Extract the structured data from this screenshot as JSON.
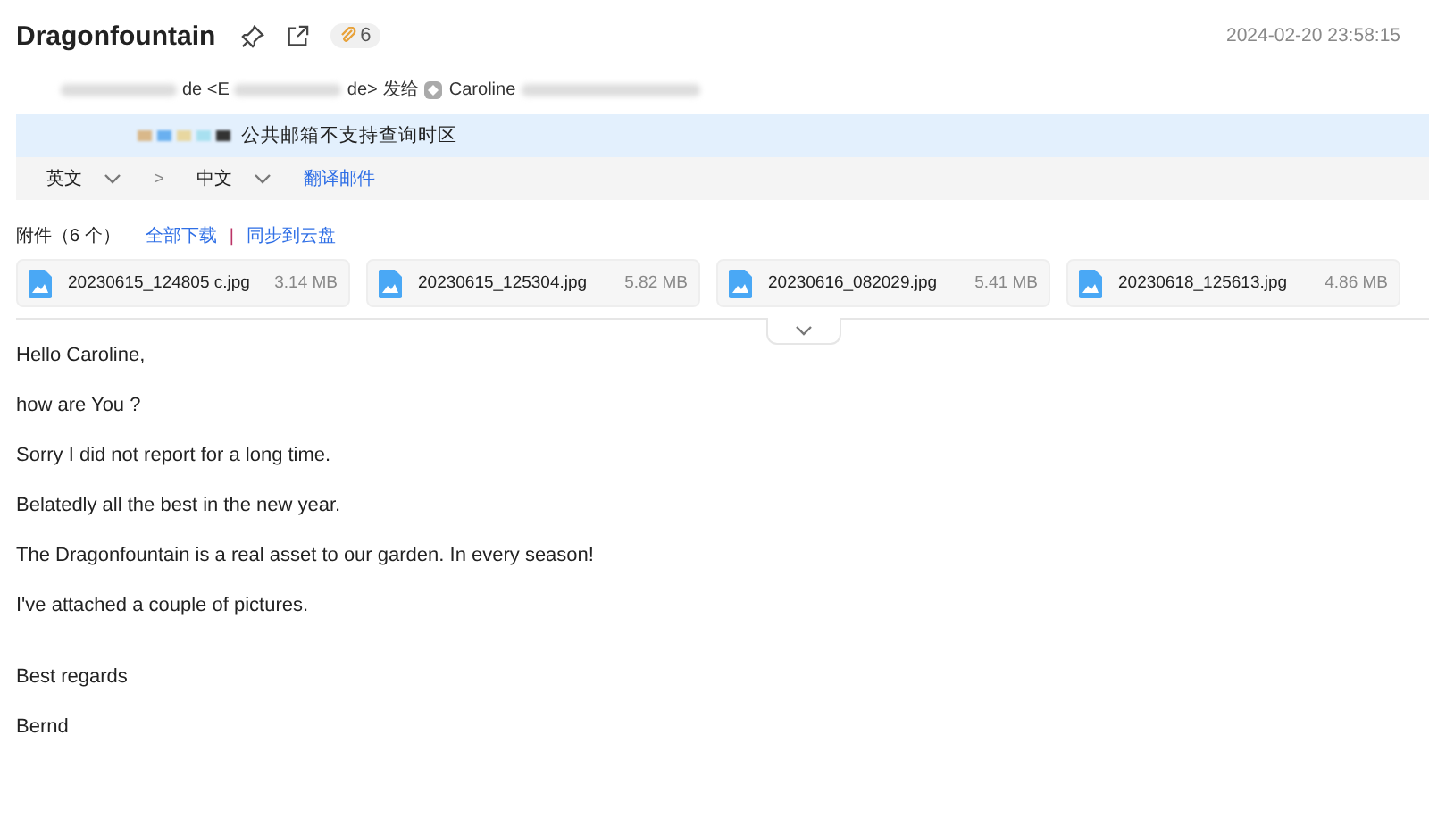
{
  "header": {
    "subject": "Dragonfountain",
    "attachment_count": "6",
    "date": "2024-02-20 23:58:15"
  },
  "sender_line": {
    "sender_start": "de <E",
    "sender_end": "de>",
    "sent_to": "发给",
    "recipient": "Caroline"
  },
  "timezone_notice": "公共邮箱不支持查询时区",
  "translate_bar": {
    "source_language": "英文",
    "separator": ">",
    "target_language": "中文",
    "action": "翻译邮件"
  },
  "attachments": {
    "title": "附件（6 个）",
    "download_all": "全部下载",
    "separator": "|",
    "save_to_cloud": "同步到云盘",
    "files": [
      {
        "name": "20230615_124805 c.jpg",
        "size": "3.14 MB"
      },
      {
        "name": "20230615_125304.jpg",
        "size": "5.82 MB"
      },
      {
        "name": "20230616_082029.jpg",
        "size": "5.41 MB"
      },
      {
        "name": "20230618_125613.jpg",
        "size": "4.86 MB"
      }
    ]
  },
  "body": [
    "Hello Caroline,",
    "how are You ?",
    "Sorry I did not report for a long time.",
    "Belatedly all the best in the new year.",
    "The Dragonfountain is a real asset to our garden. In every season!",
    "I've attached a couple of pictures."
  ],
  "closing": [
    "Best regards",
    "Bernd"
  ]
}
